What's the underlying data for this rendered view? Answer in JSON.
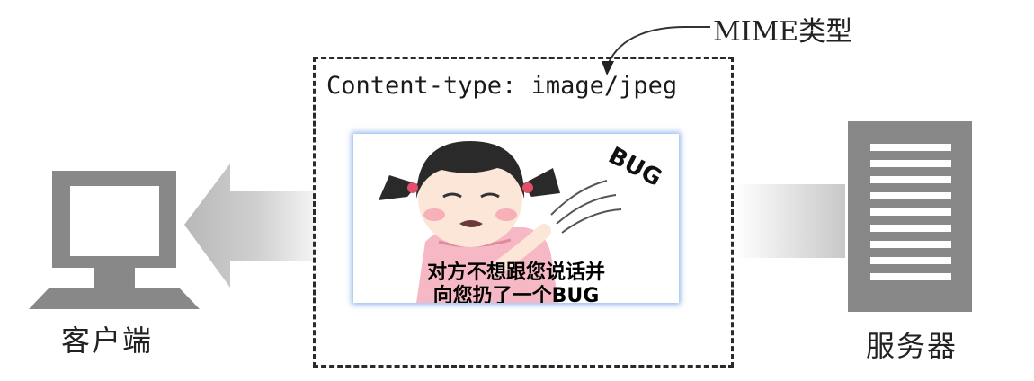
{
  "mime_label": "MIME类型",
  "header_line": "Content-type: image/jpeg",
  "client_label": "客户端",
  "server_label": "服务器",
  "meme": {
    "bug_word": "BUG",
    "caption_line1": "对方不想跟您说话并",
    "caption_line2": "向您扔了一个BUG"
  },
  "colors": {
    "device_gray": "#888888",
    "arrow_gray": "#b8b8b8",
    "dashed_border": "#2a2a2a"
  }
}
